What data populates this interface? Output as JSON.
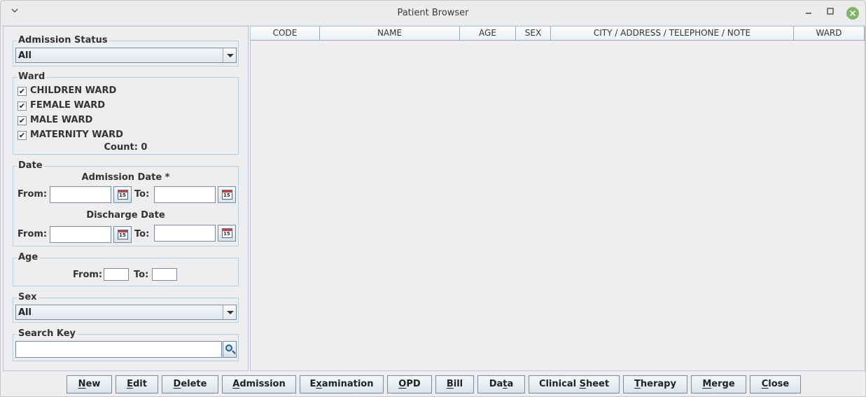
{
  "window": {
    "title": "Patient Browser",
    "menu_icon": "chevron-down-icon",
    "min_icon": "minimize-icon",
    "max_icon": "maximize-icon",
    "close_icon": "close-icon",
    "close_color": "#7fb56a"
  },
  "filters": {
    "admission_status": {
      "legend": "Admission Status",
      "selected": "All"
    },
    "ward": {
      "legend": "Ward",
      "items": [
        {
          "label": "CHILDREN WARD",
          "checked": true
        },
        {
          "label": "FEMALE WARD",
          "checked": true
        },
        {
          "label": "MALE WARD",
          "checked": true
        },
        {
          "label": "MATERNITY WARD",
          "checked": true
        }
      ],
      "count_label": "Count: 0"
    },
    "date": {
      "legend": "Date",
      "admission_title": "Admission Date *",
      "discharge_title": "Discharge Date",
      "from_label": "From:",
      "to_label": "To:",
      "admission_from": "",
      "admission_to": "",
      "discharge_from": "",
      "discharge_to": "",
      "calendar_day": "15"
    },
    "age": {
      "legend": "Age",
      "from_label": "From:",
      "to_label": "To:",
      "from": "",
      "to": ""
    },
    "sex": {
      "legend": "Sex",
      "selected": "All"
    },
    "search": {
      "legend": "Search Key",
      "value": "",
      "icon": "search-icon"
    }
  },
  "table": {
    "columns": [
      "CODE",
      "NAME",
      "AGE",
      "SEX",
      "CITY / ADDRESS / TELEPHONE / NOTE",
      "WARD"
    ],
    "rows": []
  },
  "buttons": [
    {
      "id": "new",
      "pre": "",
      "mn": "N",
      "post": "ew"
    },
    {
      "id": "edit",
      "pre": "",
      "mn": "E",
      "post": "dit"
    },
    {
      "id": "delete",
      "pre": "",
      "mn": "D",
      "post": "elete"
    },
    {
      "id": "admission",
      "pre": "",
      "mn": "A",
      "post": "dmission"
    },
    {
      "id": "examination",
      "pre": "E",
      "mn": "x",
      "post": "amination"
    },
    {
      "id": "opd",
      "pre": "",
      "mn": "O",
      "post": "PD"
    },
    {
      "id": "bill",
      "pre": "",
      "mn": "B",
      "post": "ill"
    },
    {
      "id": "data",
      "pre": "Da",
      "mn": "t",
      "post": "a"
    },
    {
      "id": "clinical-sheet",
      "pre": "Clinical ",
      "mn": "S",
      "post": "heet"
    },
    {
      "id": "therapy",
      "pre": "",
      "mn": "T",
      "post": "herapy"
    },
    {
      "id": "merge",
      "pre": "",
      "mn": "M",
      "post": "erge"
    },
    {
      "id": "close",
      "pre": "",
      "mn": "C",
      "post": "lose"
    }
  ]
}
